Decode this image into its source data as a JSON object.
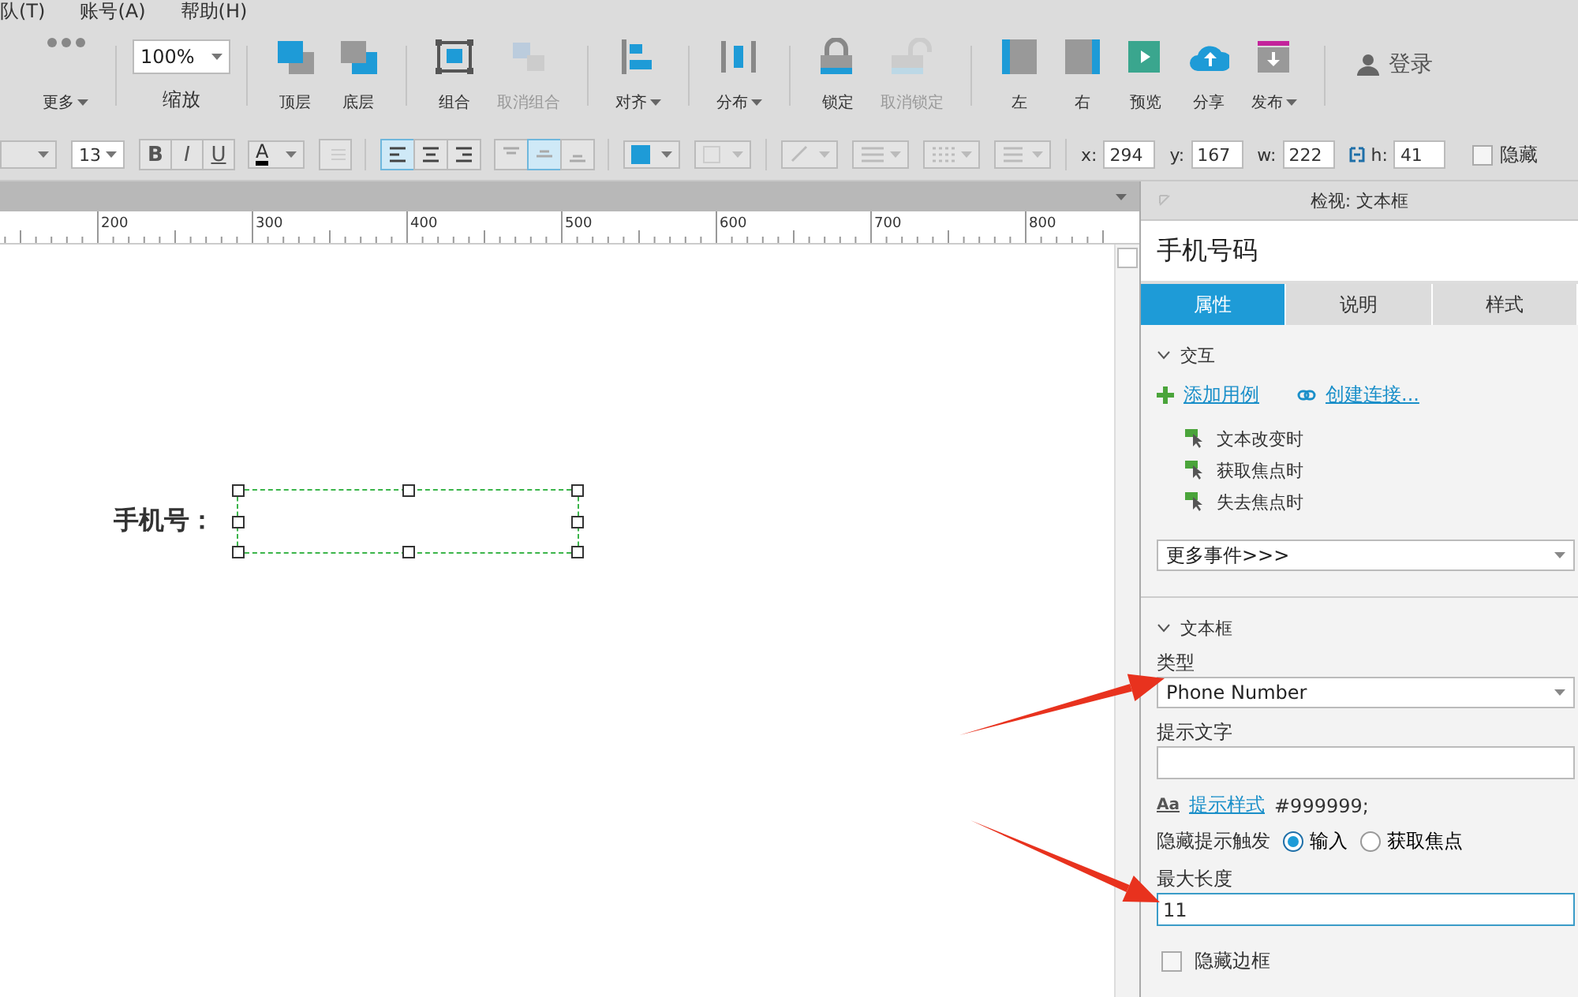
{
  "menu": [
    {
      "label": "队(T)"
    },
    {
      "label": "账号(A)"
    },
    {
      "label": "帮助(H)"
    }
  ],
  "toolbar": {
    "left": [
      {
        "kind": "dots",
        "label": "更多",
        "dropdown": true,
        "disabled": false
      },
      {
        "kind": "zoom",
        "label": "缩放",
        "value": "100%"
      },
      {
        "kind": "front",
        "label": "顶层",
        "dropdown": false,
        "disabled": false
      },
      {
        "kind": "back",
        "label": "底层",
        "dropdown": false,
        "disabled": false
      },
      {
        "kind": "group",
        "label": "组合",
        "dropdown": false,
        "disabled": false
      },
      {
        "kind": "ungroup",
        "label": "取消组合",
        "dropdown": false,
        "disabled": true
      },
      {
        "kind": "align",
        "label": "对齐",
        "dropdown": true,
        "disabled": false
      },
      {
        "kind": "distribute",
        "label": "分布",
        "dropdown": true,
        "disabled": false
      },
      {
        "kind": "lock",
        "label": "锁定",
        "dropdown": false,
        "disabled": false
      },
      {
        "kind": "unlock",
        "label": "取消锁定",
        "dropdown": false,
        "disabled": true
      },
      {
        "kind": "left",
        "label": "左",
        "dropdown": false,
        "disabled": false
      },
      {
        "kind": "right",
        "label": "右",
        "dropdown": false,
        "disabled": false
      }
    ],
    "right": [
      {
        "kind": "preview",
        "label": "预览",
        "dropdown": false,
        "disabled": false
      },
      {
        "kind": "share",
        "label": "分享",
        "dropdown": false,
        "disabled": false
      },
      {
        "kind": "publish",
        "label": "发布",
        "dropdown": true,
        "disabled": false
      }
    ],
    "login": "登录"
  },
  "format_bar": {
    "font_size": "13",
    "styles": [
      {
        "kind": "bold",
        "label": "B"
      },
      {
        "kind": "italic",
        "label": "I"
      },
      {
        "kind": "underline",
        "label": "U"
      }
    ],
    "font_color": {
      "label": "A",
      "color": "#000000"
    },
    "align": [
      {
        "kind": "left",
        "selected": true
      },
      {
        "kind": "center",
        "selected": false
      },
      {
        "kind": "right",
        "selected": false
      }
    ],
    "valign": [
      {
        "kind": "top",
        "selected": false
      },
      {
        "kind": "middle",
        "selected": true
      },
      {
        "kind": "bottom",
        "selected": false
      }
    ],
    "fill": {
      "color": "#1e9bd7"
    },
    "position": [
      {
        "label": "x:",
        "value": "294"
      },
      {
        "label": "y:",
        "value": "167"
      },
      {
        "label": "w:",
        "value": "222"
      },
      {
        "label": "h:",
        "value": "41"
      }
    ],
    "hidden": {
      "label": "隐藏",
      "checked": false
    }
  },
  "canvas": {
    "ruler": [
      "200",
      "300",
      "400",
      "500",
      "600",
      "700",
      "800"
    ],
    "widget": {
      "label": "手机号：",
      "selected": true
    }
  },
  "inspector": {
    "header": "检视: 文本框",
    "name": "手机号码",
    "tabs": [
      {
        "label": "属性",
        "selected": true
      },
      {
        "label": "说明",
        "selected": false
      },
      {
        "label": "样式",
        "selected": false
      }
    ],
    "interactions": {
      "title": "交互",
      "expanded": true,
      "add_case": "添加用例",
      "create_link": "创建连接...",
      "events": [
        {
          "label": "文本改变时"
        },
        {
          "label": "获取焦点时"
        },
        {
          "label": "失去焦点时"
        }
      ],
      "more_events": "更多事件>>>"
    },
    "textbox": {
      "title": "文本框",
      "expanded": true,
      "type_label": "类型",
      "type_value": "Phone Number",
      "hint_label": "提示文字",
      "hint_style_icon": "Aa",
      "hint_style": "提示样式",
      "hint_color": "#999999;",
      "hide_hint_label": "隐藏提示触发",
      "hide_hint_options": [
        {
          "label": "输入",
          "selected": true
        },
        {
          "label": "获取焦点",
          "selected": false
        }
      ],
      "max_length_label": "最大长度",
      "max_length": "11",
      "hide_border": {
        "label": "隐藏边框",
        "checked": false
      }
    }
  },
  "annotations": [
    {
      "kind": "arrow"
    },
    {
      "kind": "arrow"
    }
  ]
}
